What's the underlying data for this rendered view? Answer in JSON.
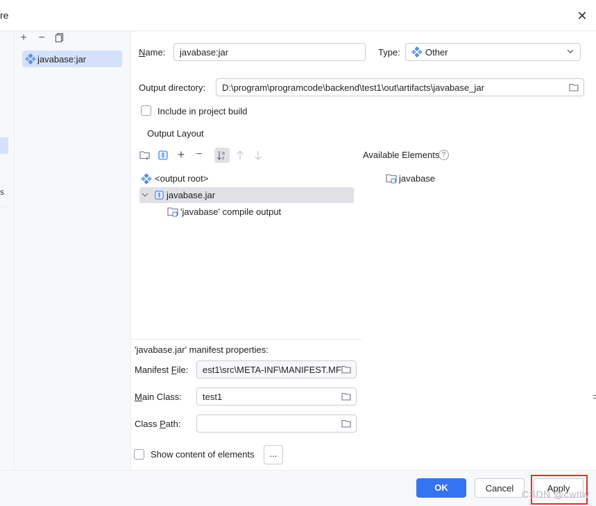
{
  "window": {
    "title_fragment": "re"
  },
  "artifacts": {
    "items": [
      {
        "label": "javabase:jar"
      }
    ]
  },
  "form": {
    "name_label": "Name:",
    "name_value": "javabase:jar",
    "type_label": "Type:",
    "type_value": "Other",
    "output_dir_label": "Output directory:",
    "output_dir_value": "D:\\program\\programcode\\backend\\test1\\out\\artifacts\\javabase_jar",
    "include_build_label": "Include in project build",
    "include_build_checked": false
  },
  "layout": {
    "tab_label": "Output Layout",
    "tree": [
      {
        "label": "<output root>"
      },
      {
        "label": "javabase.jar"
      },
      {
        "label": "'javabase' compile output"
      }
    ],
    "available_label": "Available Elements",
    "available_items": [
      {
        "label": "javabase"
      }
    ]
  },
  "manifest": {
    "title": "'javabase.jar' manifest properties:",
    "file_label": "Manifest File:",
    "file_value": "est1\\src\\META-INF\\MANIFEST.MF",
    "main_class_label": "Main Class:",
    "main_class_value": "test1",
    "class_path_label": "Class Path:",
    "class_path_value": ""
  },
  "show_content_label": "Show content of elements",
  "show_content_more": "...",
  "footer": {
    "ok": "OK",
    "cancel": "Cancel",
    "apply": "Apply"
  },
  "watermark": "CSDN @cwtlw",
  "colors": {
    "accent": "#3574f0",
    "selection": "#d5e1fb",
    "highlight_box": "#e52b2b"
  }
}
